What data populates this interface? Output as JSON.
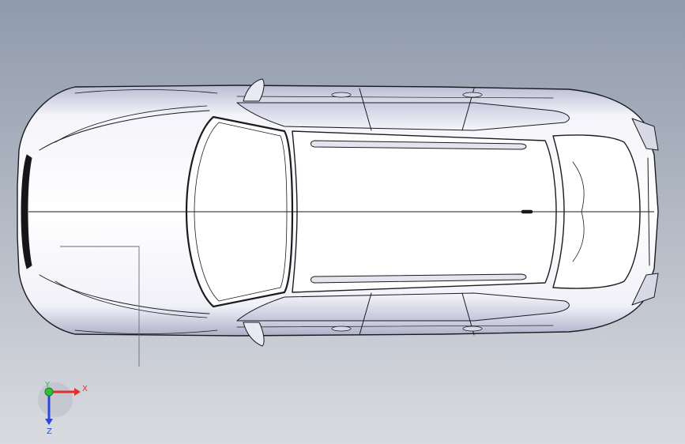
{
  "viewport": {
    "background_top": "#8f9aab",
    "background_bottom": "#d9dbe0",
    "model_fill": "#ffffff",
    "model_shade": "#c7c9dc",
    "edge_color": "#1b1b22"
  },
  "triad": {
    "x_label": "X",
    "y_label": "Y",
    "z_label": "Z",
    "x_color": "#e0302b",
    "y_color": "#2fbf3a",
    "z_color": "#2a48d8"
  }
}
